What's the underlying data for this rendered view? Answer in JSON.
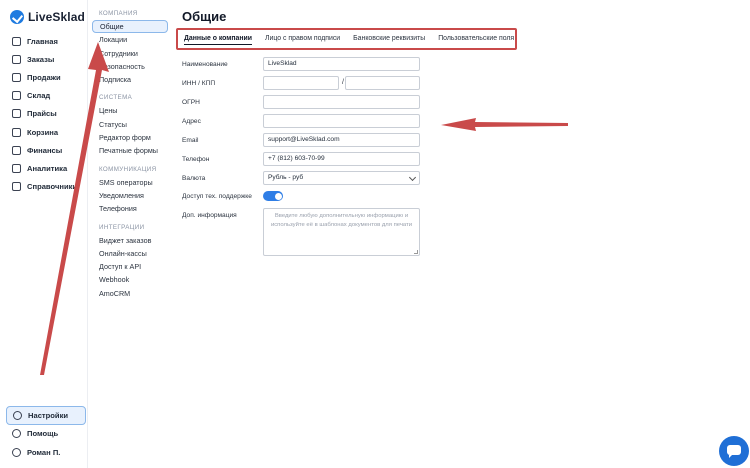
{
  "brand": {
    "name": "LiveSklad",
    "accent": "#1f7be0"
  },
  "nav": {
    "items": [
      {
        "label": "Главная",
        "icon": "home-icon"
      },
      {
        "label": "Заказы",
        "icon": "orders-icon"
      },
      {
        "label": "Продажи",
        "icon": "cart-icon"
      },
      {
        "label": "Склад",
        "icon": "box-icon"
      },
      {
        "label": "Прайсы",
        "icon": "price-tag-icon"
      },
      {
        "label": "Корзина",
        "icon": "trash-icon"
      },
      {
        "label": "Финансы",
        "icon": "wallet-icon"
      },
      {
        "label": "Аналитика",
        "icon": "chart-icon"
      },
      {
        "label": "Справочники",
        "icon": "book-icon"
      }
    ],
    "bottom": [
      {
        "label": "Настройки",
        "icon": "gear-icon"
      },
      {
        "label": "Помощь",
        "icon": "help-icon"
      },
      {
        "label": "Роман П.",
        "icon": "user-icon"
      }
    ]
  },
  "submenu": {
    "groups": [
      {
        "title": "КОМПАНИЯ",
        "items": [
          "Общие",
          "Локации",
          "Сотрудники",
          "Безопасность",
          "Подписка"
        ]
      },
      {
        "title": "СИСТЕМА",
        "items": [
          "Цены",
          "Статусы",
          "Редактор форм",
          "Печатные формы"
        ]
      },
      {
        "title": "КОММУНИКАЦИЯ",
        "items": [
          "SMS операторы",
          "Уведомления",
          "Телефония"
        ]
      },
      {
        "title": "ИНТЕГРАЦИИ",
        "items": [
          "Виджет заказов",
          "Онлайн-кассы",
          "Доступ к API",
          "Webhook",
          "AmoCRM"
        ]
      }
    ]
  },
  "page": {
    "title": "Общие"
  },
  "tabs": [
    "Данные о компании",
    "Лицо с правом подписи",
    "Банковские реквизиты",
    "Пользовательские поля"
  ],
  "form": {
    "name_label": "Наименование",
    "name_value": "LiveSklad",
    "inn_label": "ИНН / КПП",
    "inn_value": "",
    "kpp_value": "",
    "inn_separator": "/",
    "ogrn_label": "ОГРН",
    "ogrn_value": "",
    "address_label": "Адрес",
    "address_value": "",
    "email_label": "Email",
    "email_value": "support@LiveSklad.com",
    "phone_label": "Телефон",
    "phone_value": "+7 (812) 603-70-99",
    "currency_label": "Валюта",
    "currency_value": "Рубль - руб",
    "support_label": "Доступ тех. поддержке",
    "support_enabled": true,
    "extra_label": "Доп. информация",
    "extra_placeholder": "Введите любую дополнительную информацию и используйте её в шаблонах документов для печати"
  },
  "colors": {
    "annotation": "#c94a4a",
    "toggle": "#2f7ee6",
    "chat": "#1f6fd6"
  }
}
